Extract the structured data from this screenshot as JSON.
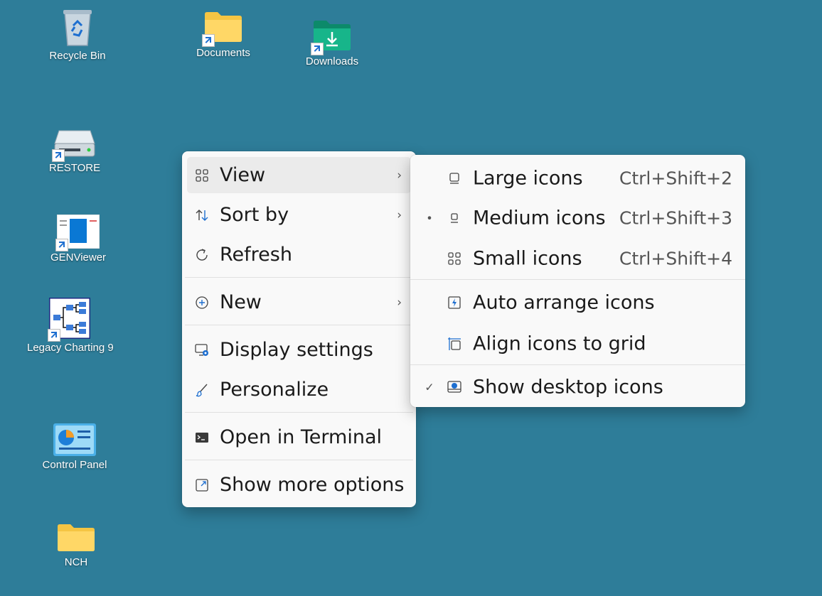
{
  "desktop": {
    "background": "#2e7d99",
    "icons": {
      "recycle_bin": "Recycle Bin",
      "documents": "Documents",
      "downloads": "Downloads",
      "restore": "RESTORE",
      "genviewer": "GENViewer",
      "legacy_charting": "Legacy Charting 9",
      "control_panel": "Control Panel",
      "nch": "NCH"
    }
  },
  "context_menu": {
    "items": {
      "view": "View",
      "sort_by": "Sort by",
      "refresh": "Refresh",
      "new": "New",
      "display_settings": "Display settings",
      "personalize": "Personalize",
      "open_terminal": "Open in Terminal",
      "show_more": "Show more options"
    },
    "highlighted": "View"
  },
  "view_submenu": {
    "large": {
      "label": "Large icons",
      "shortcut": "Ctrl+Shift+2"
    },
    "medium": {
      "label": "Medium icons",
      "shortcut": "Ctrl+Shift+3",
      "selected": true
    },
    "small": {
      "label": "Small icons",
      "shortcut": "Ctrl+Shift+4"
    },
    "auto_arrange": {
      "label": "Auto arrange icons",
      "checked": false
    },
    "align_grid": {
      "label": "Align icons to grid",
      "checked": false
    },
    "show_desktop": {
      "label": "Show desktop icons",
      "checked": true
    }
  }
}
